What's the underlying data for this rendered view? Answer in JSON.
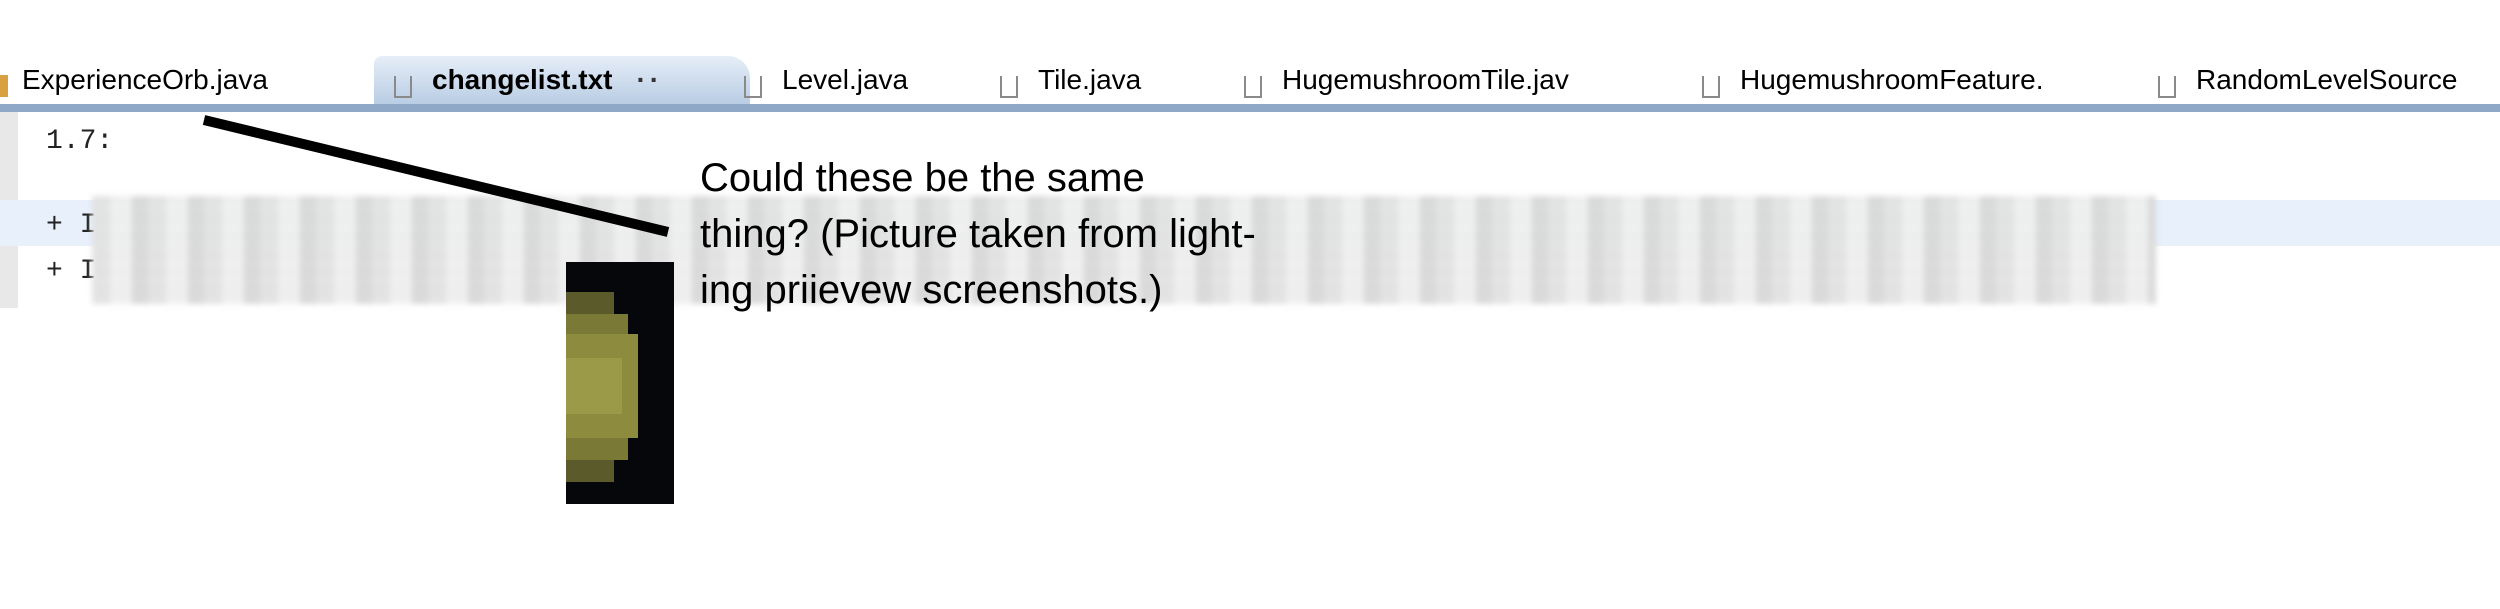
{
  "tabs": [
    {
      "label": "ExperienceOrb.java",
      "active": false
    },
    {
      "label": "changelist.txt",
      "active": true,
      "close_glyph": "··"
    },
    {
      "label": "Level.java",
      "active": false
    },
    {
      "label": "Tile.java",
      "active": false
    },
    {
      "label": "HugemushroomTile.jav",
      "active": false
    },
    {
      "label": "HugemushroomFeature.",
      "active": false
    },
    {
      "label": "RandomLevelSource",
      "active": false
    }
  ],
  "editor": {
    "lines": [
      "1.7:",
      "+ I",
      "+ I"
    ]
  },
  "annotation": {
    "lines": [
      "Could these be the same",
      "thing? (Picture taken from light-",
      "ing priievew screenshots.)"
    ]
  },
  "colors": {
    "active_tab_accent": "#b9cde4",
    "highlight_row": "#e8f0fc",
    "pointer_line": "#000000"
  }
}
